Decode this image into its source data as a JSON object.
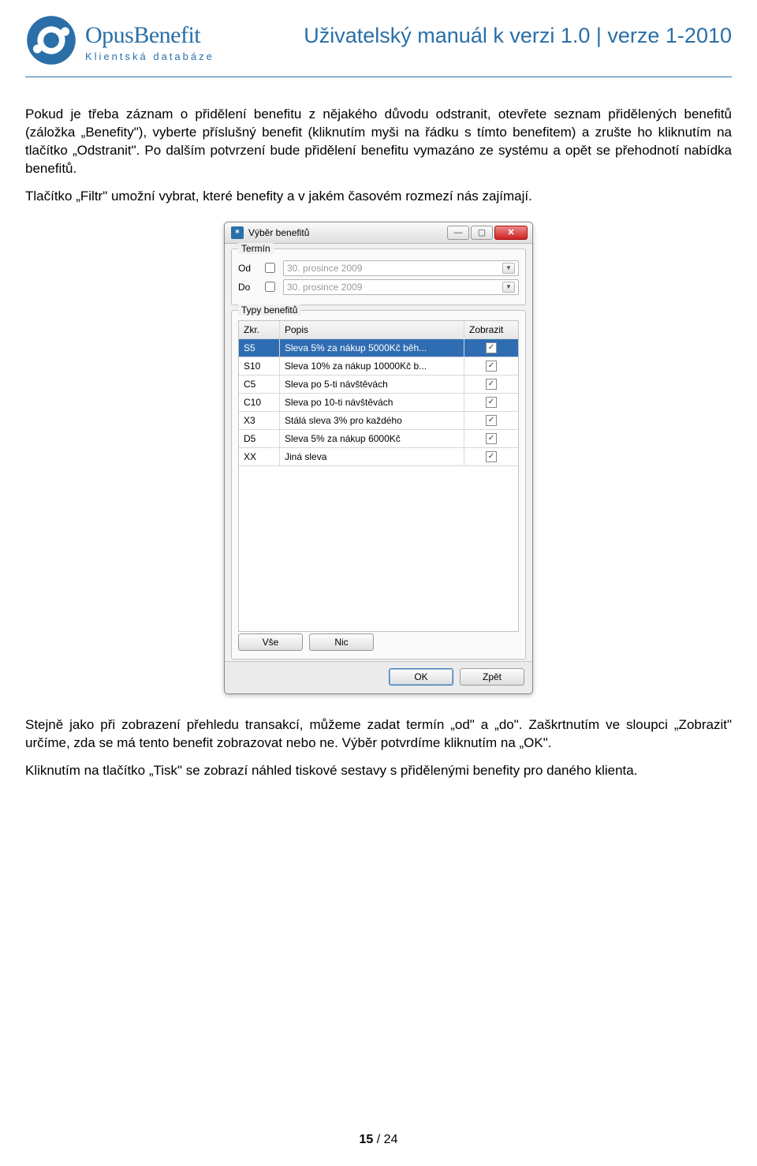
{
  "header": {
    "logo_title": "OpusBenefit",
    "logo_sub": "Klientská databáze",
    "manual_title": "Uživatelský manuál k verzi 1.0 | verze 1-2010"
  },
  "body": {
    "p1": "Pokud je třeba záznam o přidělení benefitu z nějakého důvodu odstranit, otevřete seznam přidělených benefitů (záložka „Benefity\"), vyberte příslušný benefit (kliknutím myši na řádku s tímto benefitem) a zrušte ho kliknutím na tlačítko „Odstranit\". Po dalším potvrzení bude přidělení benefitu vymazáno ze systému a opět se přehodnotí nabídka benefitů.",
    "p2": "Tlačítko „Filtr\" umožní vybrat, které benefity a v jakém časovém rozmezí nás zajímají.",
    "p3": "Stejně jako při zobrazení přehledu transakcí, můžeme zadat termín „od\" a „do\". Zaškrtnutím ve sloupci „Zobrazit\" určíme, zda se má tento benefit zobrazovat nebo ne. Výběr potvrdíme kliknutím na „OK\".",
    "p4": "Kliknutím na tlačítko „Tisk\" se zobrazí náhled tiskové sestavy s přidělenými benefity pro daného klienta."
  },
  "dialog": {
    "title": "Výběr benefitů",
    "group_termin": "Termín",
    "label_od": "Od",
    "label_do": "Do",
    "date_value": "30. prosince  2009",
    "group_types": "Typy benefitů",
    "col_zkr": "Zkr.",
    "col_popis": "Popis",
    "col_zobrazit": "Zobrazit",
    "rows": [
      {
        "zkr": "S5",
        "popis": "Sleva 5% za nákup 5000Kč běh..."
      },
      {
        "zkr": "S10",
        "popis": "Sleva 10% za nákup 10000Kč b..."
      },
      {
        "zkr": "C5",
        "popis": "Sleva po 5-ti návštěvách"
      },
      {
        "zkr": "C10",
        "popis": "Sleva po 10-ti návštěvách"
      },
      {
        "zkr": "X3",
        "popis": "Stálá sleva 3% pro každého"
      },
      {
        "zkr": "D5",
        "popis": "Sleva 5% za nákup 6000Kč"
      },
      {
        "zkr": "XX",
        "popis": "Jiná sleva"
      }
    ],
    "btn_vse": "Vše",
    "btn_nic": "Nic",
    "btn_ok": "OK",
    "btn_zpet": "Zpět"
  },
  "footer": {
    "current": "15",
    "sep": " / ",
    "total": "24"
  }
}
